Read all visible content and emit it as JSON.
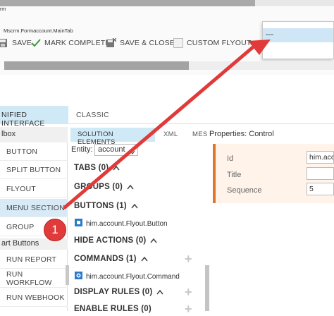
{
  "ribbon": {
    "form_name": "rm",
    "form_path": "Mscrm.Formaccount.MainTab",
    "buttons": [
      {
        "label": "SAVE",
        "icon": "save-icon"
      },
      {
        "label": "MARK COMPLETE",
        "icon": "checkmark-icon"
      },
      {
        "label": "SAVE & CLOSE",
        "icon": "save-close-icon"
      },
      {
        "label": "CUSTOM FLYOUT",
        "icon": "flyout-icon"
      }
    ],
    "flyout_item": "---"
  },
  "tabs": {
    "unified": "NIFIED INTERFACE",
    "classic": "CLASSIC"
  },
  "toolbox": {
    "header": "lbox",
    "items": [
      "BUTTON",
      "SPLIT BUTTON",
      "FLYOUT",
      "MENU SECTION",
      "GROUP"
    ],
    "group_header": "art Buttons",
    "smart_buttons": [
      "RUN REPORT",
      "RUN WORKFLOW",
      "RUN WEBHOOK"
    ]
  },
  "solution": {
    "tabs": [
      "SOLUTION ELEMENTS",
      "XML",
      "MES"
    ],
    "entity_label": "Entity:",
    "entity_value": "account",
    "sections": {
      "tabs": "TABS (0)",
      "groups": "GROUPS (0)",
      "buttons": "BUTTONS (1)",
      "buttons_item": "him.account.Flyout.Button",
      "hide_actions": "HIDE ACTIONS (0)",
      "commands": "COMMANDS (1)",
      "commands_item": "him.account.Flyout.Command",
      "display_rules": "DISPLAY RULES (0)",
      "enable_rules": "ENABLE RULES (0)"
    }
  },
  "properties": {
    "title": "Properties: Control",
    "fields": [
      {
        "label": "Id",
        "value": "him.acc"
      },
      {
        "label": "Title",
        "value": ""
      },
      {
        "label": "Sequence",
        "value": "5"
      }
    ]
  },
  "annotation": {
    "badge": "1",
    "arrow_color": "#e03a3a"
  }
}
